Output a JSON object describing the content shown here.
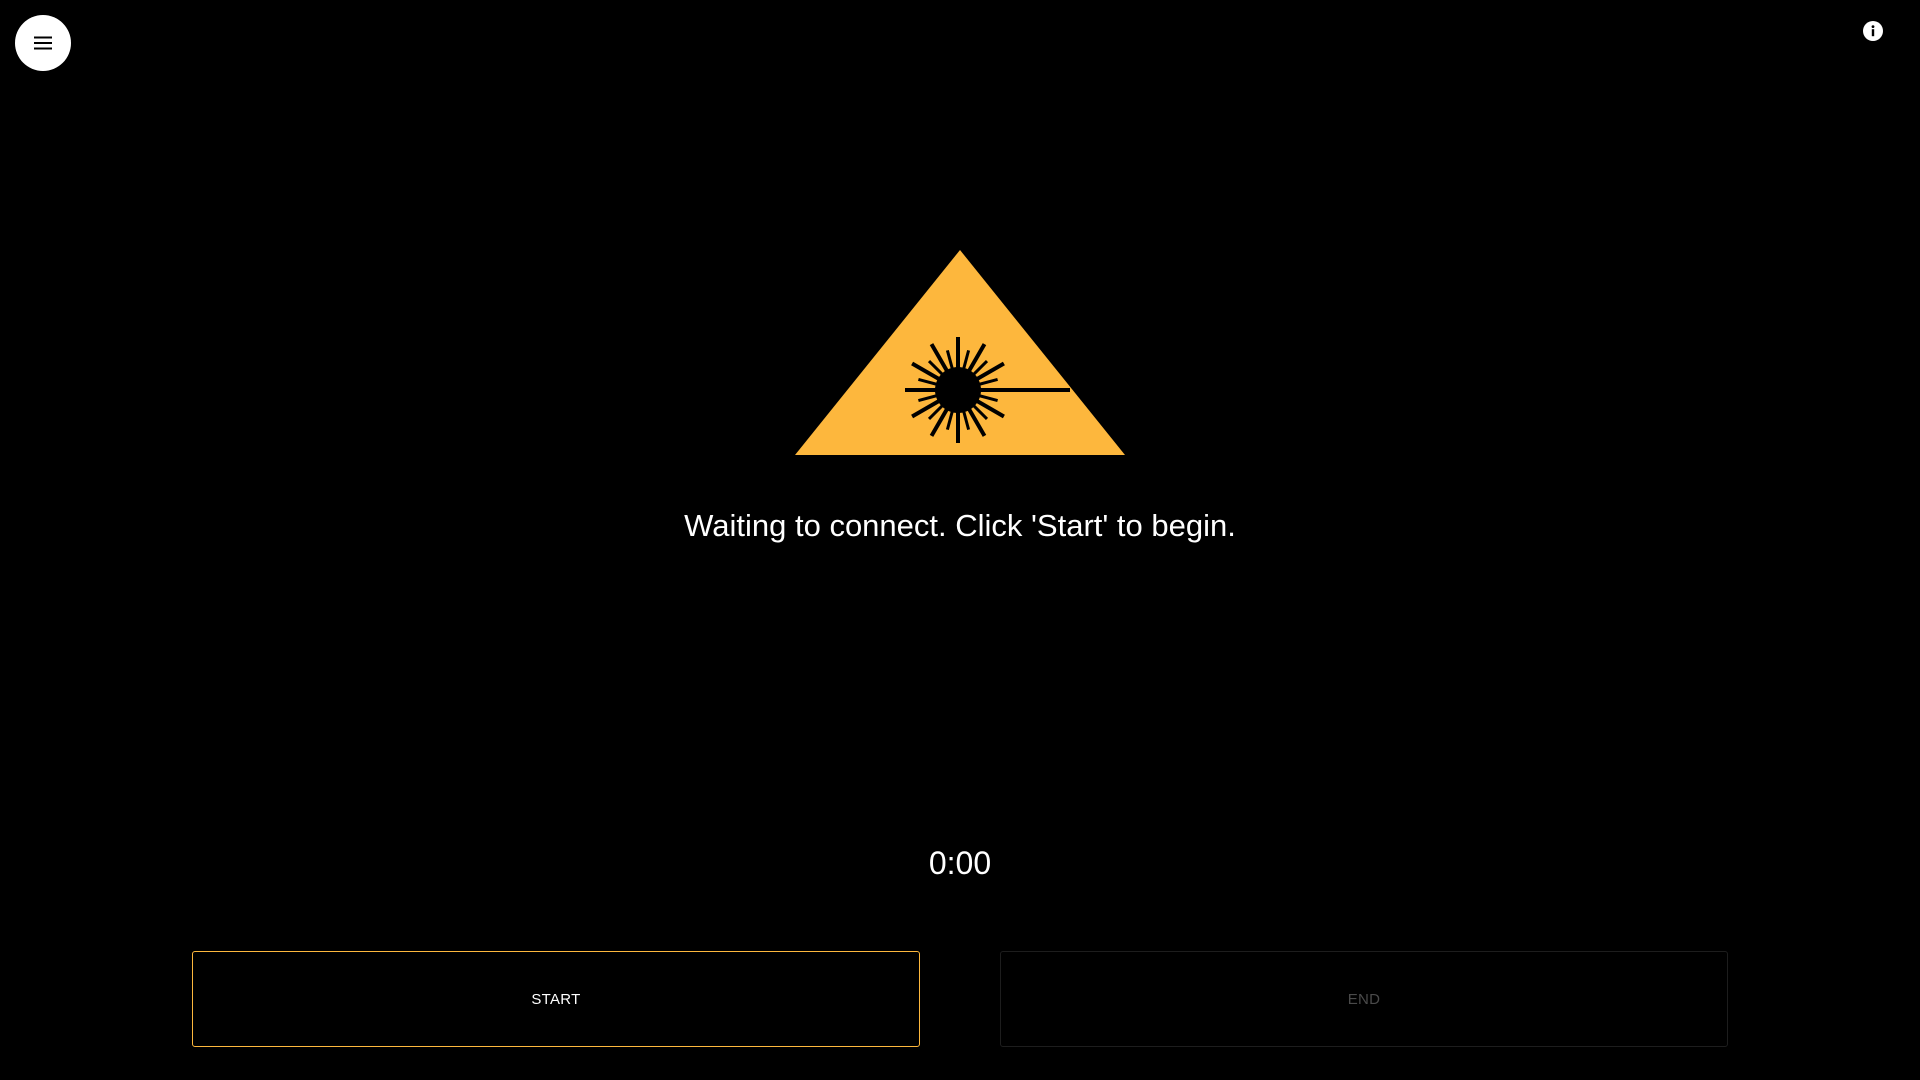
{
  "header": {
    "menu_icon": "hamburger-menu-icon",
    "info_icon": "info-icon"
  },
  "main": {
    "warning_icon": "laser-warning-icon",
    "status_text": "Waiting to connect. Click 'Start' to begin.",
    "timer": "0:00"
  },
  "controls": {
    "start_label": "START",
    "end_label": "END",
    "end_disabled": true
  },
  "colors": {
    "background": "#000000",
    "accent": "#fdb73d",
    "text": "#ffffff",
    "disabled_text": "#4a4a4a"
  }
}
